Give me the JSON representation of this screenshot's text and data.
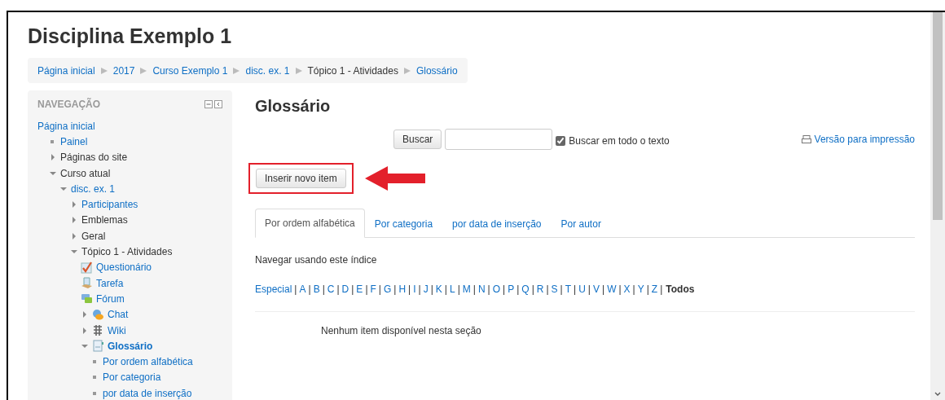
{
  "page_title": "Disciplina Exemplo 1",
  "breadcrumb": [
    {
      "label": "Página inicial",
      "link": true
    },
    {
      "label": "2017",
      "link": true
    },
    {
      "label": "Curso Exemplo 1",
      "link": true
    },
    {
      "label": "disc. ex. 1",
      "link": true
    },
    {
      "label": "Tópico 1 - Atividades",
      "link": false
    },
    {
      "label": "Glossário",
      "link": true
    }
  ],
  "navigation": {
    "title": "NAVEGAÇÃO",
    "items": [
      {
        "label": "Página inicial",
        "link": true,
        "kind": "plain"
      },
      {
        "label": "Painel",
        "link": true,
        "kind": "bullet"
      },
      {
        "label": "Páginas do site",
        "link": false,
        "expanded": false,
        "kind": "branch"
      },
      {
        "label": "Curso atual",
        "link": false,
        "expanded": true,
        "kind": "branch",
        "children": [
          {
            "label": "disc. ex. 1",
            "link": true,
            "expanded": true,
            "kind": "branch",
            "children": [
              {
                "label": "Participantes",
                "link": true,
                "expanded": false,
                "kind": "branch"
              },
              {
                "label": "Emblemas",
                "link": false,
                "expanded": false,
                "kind": "branch"
              },
              {
                "label": "Geral",
                "link": false,
                "expanded": false,
                "kind": "branch"
              },
              {
                "label": "Tópico 1 - Atividades",
                "link": false,
                "expanded": true,
                "kind": "branch",
                "children": [
                  {
                    "label": "Questionário",
                    "link": true,
                    "kind": "quiz"
                  },
                  {
                    "label": "Tarefa",
                    "link": true,
                    "kind": "assign"
                  },
                  {
                    "label": "Fórum",
                    "link": true,
                    "kind": "forum"
                  },
                  {
                    "label": "Chat",
                    "link": true,
                    "expanded": false,
                    "kind": "chat"
                  },
                  {
                    "label": "Wiki",
                    "link": true,
                    "expanded": false,
                    "kind": "wiki"
                  },
                  {
                    "label": "Glossário",
                    "link": true,
                    "current": true,
                    "expanded": true,
                    "kind": "glossary",
                    "children": [
                      {
                        "label": "Por ordem alfabética",
                        "link": true,
                        "kind": "bullet"
                      },
                      {
                        "label": "Por categoria",
                        "link": true,
                        "kind": "bullet"
                      },
                      {
                        "label": "por data de inserção",
                        "link": true,
                        "kind": "bullet"
                      }
                    ]
                  }
                ]
              }
            ]
          }
        ]
      }
    ]
  },
  "main": {
    "heading": "Glossário",
    "search": {
      "button": "Buscar",
      "checkbox_label": "Buscar em todo o texto",
      "checked": true
    },
    "print_link": "Versão para impressão",
    "add_button": "Inserir novo item",
    "tabs": [
      {
        "label": "Por ordem alfabética",
        "selected": true
      },
      {
        "label": "Por categoria",
        "selected": false
      },
      {
        "label": "por data de inserção",
        "selected": false
      },
      {
        "label": "Por autor",
        "selected": false
      }
    ],
    "index_caption": "Navegar usando este índice",
    "separator": "|",
    "index": [
      {
        "label": "Especial",
        "selected": false
      },
      {
        "label": "A",
        "selected": false
      },
      {
        "label": "B",
        "selected": false
      },
      {
        "label": "C",
        "selected": false
      },
      {
        "label": "D",
        "selected": false
      },
      {
        "label": "E",
        "selected": false
      },
      {
        "label": "F",
        "selected": false
      },
      {
        "label": "G",
        "selected": false
      },
      {
        "label": "H",
        "selected": false
      },
      {
        "label": "I",
        "selected": false
      },
      {
        "label": "J",
        "selected": false
      },
      {
        "label": "K",
        "selected": false
      },
      {
        "label": "L",
        "selected": false
      },
      {
        "label": "M",
        "selected": false
      },
      {
        "label": "N",
        "selected": false
      },
      {
        "label": "O",
        "selected": false
      },
      {
        "label": "P",
        "selected": false
      },
      {
        "label": "Q",
        "selected": false
      },
      {
        "label": "R",
        "selected": false
      },
      {
        "label": "S",
        "selected": false
      },
      {
        "label": "T",
        "selected": false
      },
      {
        "label": "U",
        "selected": false
      },
      {
        "label": "V",
        "selected": false
      },
      {
        "label": "W",
        "selected": false
      },
      {
        "label": "X",
        "selected": false
      },
      {
        "label": "Y",
        "selected": false
      },
      {
        "label": "Z",
        "selected": false
      },
      {
        "label": "Todos",
        "selected": true
      }
    ],
    "empty_message": "Nenhum item disponível nesta seção"
  }
}
